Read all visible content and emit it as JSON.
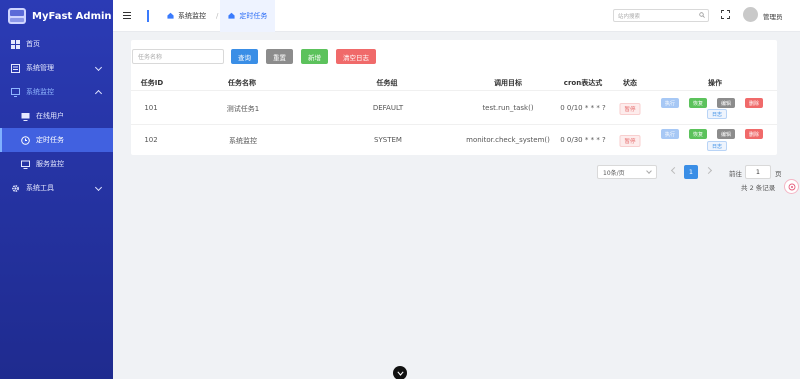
{
  "app": {
    "title": "MyFast Admin"
  },
  "sidebar": {
    "items": [
      {
        "label": "首页",
        "icon": "dashboard-icon"
      },
      {
        "label": "系统管理",
        "icon": "settings-doc-icon",
        "expandable": true
      },
      {
        "label": "系统监控",
        "icon": "monitor-icon",
        "expandable": true,
        "expanded": true
      },
      {
        "label": "在线用户",
        "icon": "screen-icon"
      },
      {
        "label": "定时任务",
        "icon": "clock-icon",
        "active": true
      },
      {
        "label": "服务监控",
        "icon": "server-monitor-icon"
      },
      {
        "label": "系统工具",
        "icon": "gear-icon",
        "expandable": true
      }
    ]
  },
  "header": {
    "tabs": [
      {
        "label": "系统监控"
      },
      {
        "label": "定时任务",
        "active": true
      }
    ],
    "search_placeholder": "站内搜索",
    "username": "管理员"
  },
  "toolbar": {
    "task_name_placeholder": "任务名称",
    "query_label": "查询",
    "reset_label": "重置",
    "add_label": "新增",
    "clear_log_label": "清空日志"
  },
  "table": {
    "columns": [
      "任务ID",
      "任务名称",
      "任务组",
      "调用目标",
      "cron表达式",
      "状态",
      "操作"
    ],
    "rows": [
      {
        "id": "101",
        "name": "测试任务1",
        "group": "DEFAULT",
        "target": "test.run_task()",
        "cron": "0 0/10 * * * ?",
        "status": "暂停"
      },
      {
        "id": "102",
        "name": "系统监控",
        "group": "SYSTEM",
        "target": "monitor.check_system()",
        "cron": "0 0/30 * * * ?",
        "status": "暂停"
      }
    ],
    "actions": {
      "run": "执行",
      "resume": "恢复",
      "edit": "编辑",
      "delete": "删除",
      "log": "日志"
    }
  },
  "pagination": {
    "page_size": "10条/页",
    "current_page": "1",
    "goto_label": "前往",
    "goto_value": "1",
    "page_unit": "页",
    "total": "共 2 条记录"
  },
  "colors": {
    "sidebar": "#2b3bb5",
    "primary": "#3a8ee6",
    "success": "#5cc25c",
    "danger": "#f06a6a",
    "neutral": "#8c8c8c"
  }
}
